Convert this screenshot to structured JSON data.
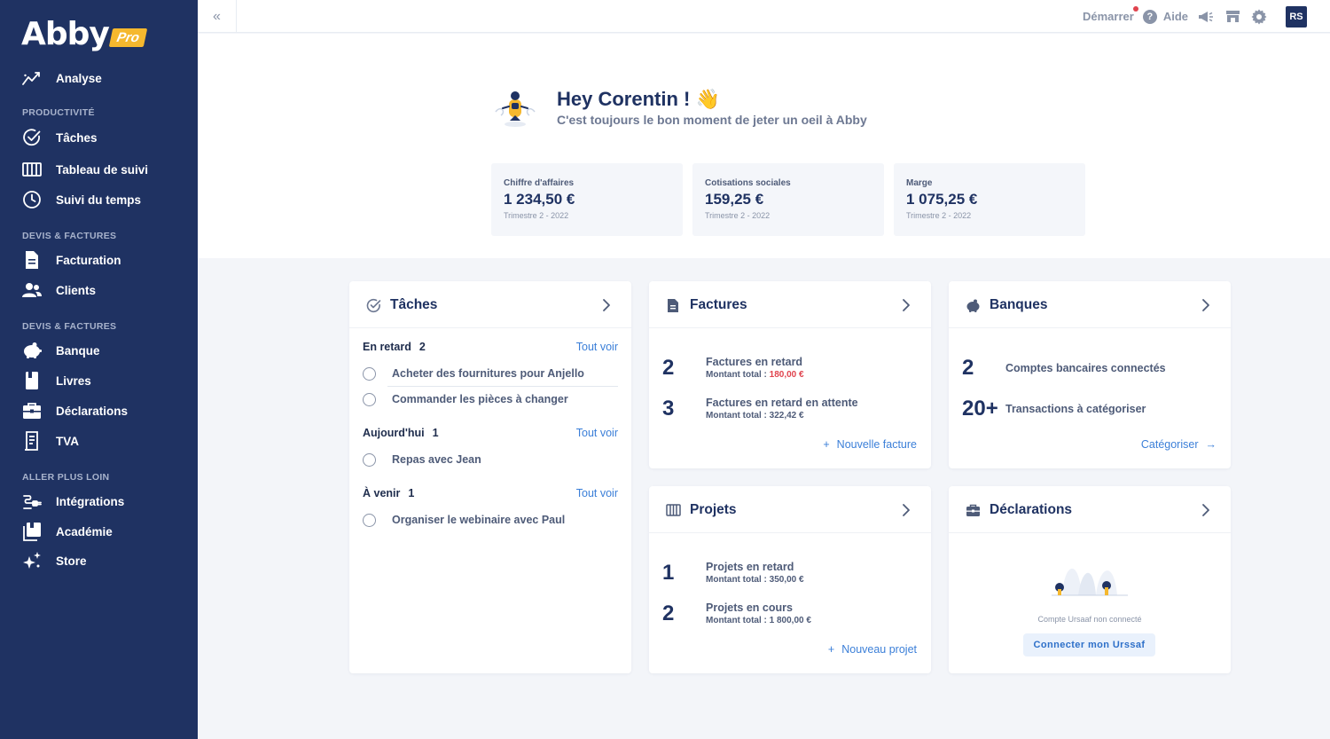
{
  "brand": {
    "name": "Abby",
    "badge": "Pro"
  },
  "sidebar": {
    "items": [
      {
        "label": "Analyse",
        "icon": "trend-icon"
      },
      {
        "label": "Tâches",
        "icon": "check-circle-icon"
      },
      {
        "label": "Tableau de suivi",
        "icon": "kanban-icon"
      },
      {
        "label": "Suivi du temps",
        "icon": "clock-icon"
      },
      {
        "label": "Facturation",
        "icon": "document-icon"
      },
      {
        "label": "Clients",
        "icon": "users-icon"
      },
      {
        "label": "Banque",
        "icon": "piggy-bank-icon"
      },
      {
        "label": "Livres",
        "icon": "book-icon"
      },
      {
        "label": "Déclarations",
        "icon": "briefcase-icon"
      },
      {
        "label": "TVA",
        "icon": "receipt-icon"
      },
      {
        "label": "Intégrations",
        "icon": "plug-icon"
      },
      {
        "label": "Académie",
        "icon": "academy-icon"
      },
      {
        "label": "Store",
        "icon": "sparkle-icon"
      }
    ],
    "sections": [
      "PRODUCTIVITÉ",
      "DEVIS & FACTURES",
      "DEVIS & FACTURES",
      "ALLER PLUS LOIN"
    ]
  },
  "topbar": {
    "start_label": "Démarrer",
    "help_label": "Aide",
    "avatar_initials": "RS"
  },
  "hero": {
    "greeting": "Hey Corentin ! 👋",
    "subtitle": "C'est toujours le bon moment de jeter un oeil à Abby"
  },
  "stats": [
    {
      "label": "Chiffre d'affaires",
      "value": "1 234,50 €",
      "period": "Trimestre 2 - 2022"
    },
    {
      "label": "Cotisations sociales",
      "value": "159,25 €",
      "period": "Trimestre 2 - 2022"
    },
    {
      "label": "Marge",
      "value": "1 075,25 €",
      "period": "Trimestre 2 - 2022"
    }
  ],
  "tasks_card": {
    "title": "Tâches",
    "see_all": "Tout voir",
    "sections": [
      {
        "name": "En retard",
        "count": "2",
        "items": [
          "Acheter des fournitures pour Anjello",
          "Commander les pièces à changer"
        ]
      },
      {
        "name": "Aujourd'hui",
        "count": "1",
        "items": [
          "Repas avec Jean"
        ]
      },
      {
        "name": "À venir",
        "count": "1",
        "items": [
          "Organiser le webinaire avec Paul"
        ]
      }
    ]
  },
  "invoices_card": {
    "title": "Factures",
    "metrics": [
      {
        "num": "2",
        "title": "Factures en retard",
        "sub_prefix": "Montant total : ",
        "sub_value": "180,00 €"
      },
      {
        "num": "3",
        "title": "Factures en retard en attente",
        "sub_prefix": "Montant total : ",
        "sub_value": "322,42 €"
      }
    ],
    "action": "Nouvelle facture"
  },
  "banks_card": {
    "title": "Banques",
    "metrics": [
      {
        "num": "2",
        "title": "Comptes bancaires connectés"
      },
      {
        "num": "20+",
        "title": "Transactions à catégoriser"
      }
    ],
    "action": "Catégoriser"
  },
  "projects_card": {
    "title": "Projets",
    "metrics": [
      {
        "num": "1",
        "title": "Projets en retard",
        "sub": "Montant total : 350,00 €"
      },
      {
        "num": "2",
        "title": "Projets en cours",
        "sub": "Montant total : 1 800,00 €"
      }
    ],
    "action": "Nouveau projet"
  },
  "declarations_card": {
    "title": "Déclarations",
    "note": "Compte Ursaaf non connecté",
    "button": "Connecter mon Urssaf"
  },
  "colors": {
    "sidebar": "#1f3262",
    "accent": "#3b7fd8",
    "alert": "#e0434d",
    "brand_badge": "#f5b82e"
  }
}
